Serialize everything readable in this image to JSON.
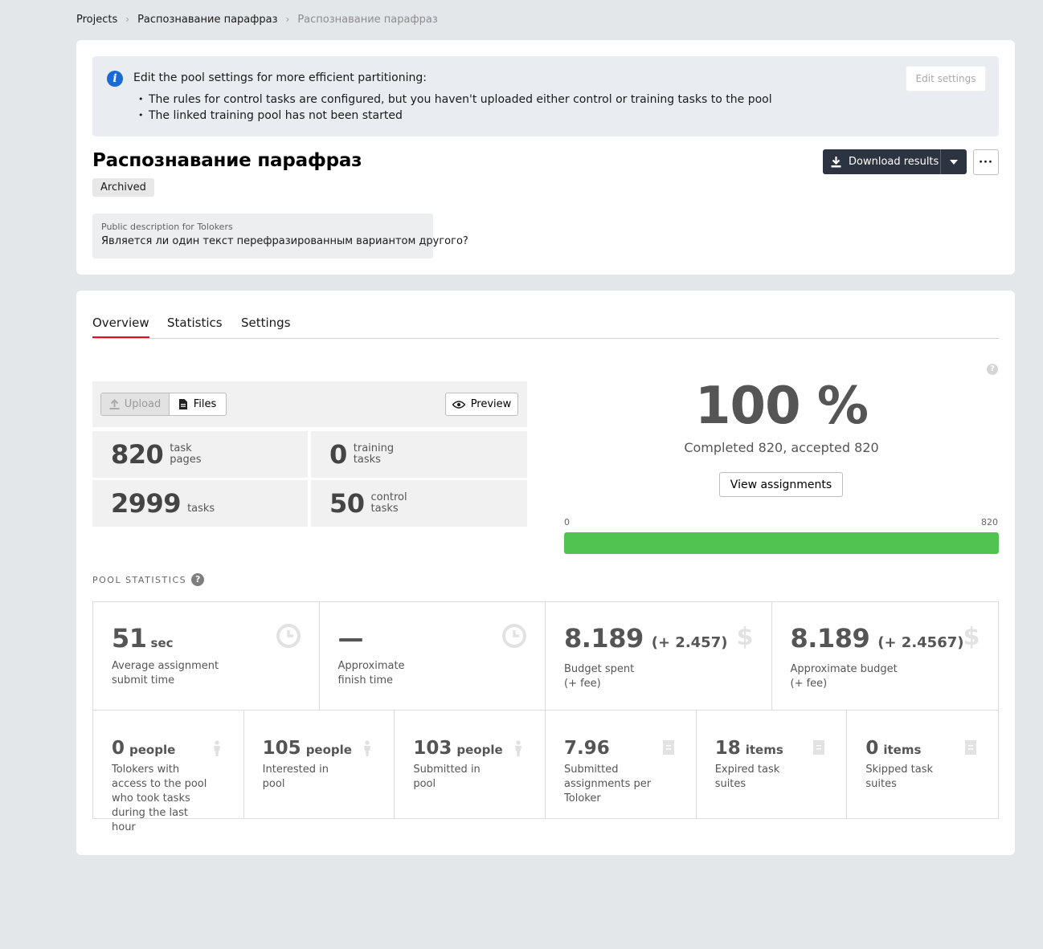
{
  "breadcrumb": {
    "items": [
      "Projects",
      "Распознавание парафраз"
    ],
    "current": "Распознавание парафраз"
  },
  "notice": {
    "title": "Edit the pool settings for more efficient partitioning:",
    "items": [
      "The rules for control tasks are configured, but you haven't uploaded either control or training tasks to the pool",
      "The linked training pool has not been started"
    ],
    "edit_button": "Edit settings"
  },
  "pool": {
    "title": "Распознавание парафраз",
    "status": "Archived",
    "description_label": "Public description for Tolokers",
    "description": "Является ли один текст перефразированным вариантом другого?"
  },
  "actions": {
    "download_label": "Download results",
    "more_label": "···"
  },
  "tabs": [
    "Overview",
    "Statistics",
    "Settings"
  ],
  "upload": {
    "upload_label": "Upload",
    "files_label": "Files",
    "preview_label": "Preview"
  },
  "counts": [
    {
      "value": "820",
      "label_1": "task",
      "label_2": "pages"
    },
    {
      "value": "0",
      "label_1": "training",
      "label_2": "tasks"
    },
    {
      "value": "2999",
      "label_1": "",
      "label_2": "tasks"
    },
    {
      "value": "50",
      "label_1": "control",
      "label_2": "tasks"
    }
  ],
  "progress": {
    "percent_text": "100 %",
    "completed_text": "Completed 820, accepted 820",
    "view_button": "View assignments",
    "scale_min": "0",
    "scale_max": "820",
    "fill_fraction": 1.0,
    "bar_color": "#51c351"
  },
  "pool_statistics": {
    "heading": "POOL STATISTICS",
    "row1": [
      {
        "value": "51",
        "unit": "sec",
        "label_1": "Average assignment",
        "label_2": "submit time",
        "icon": "clock-icon"
      },
      {
        "value": "—",
        "unit": "",
        "label_1": "Approximate",
        "label_2": "finish time",
        "icon": "clock-icon"
      },
      {
        "value": "8.189",
        "fee": "(+ 2.457)",
        "label_1": "Budget spent",
        "label_2": "(+ fee)",
        "icon": "dollar-icon"
      },
      {
        "value": "8.189",
        "fee": "(+ 2.4567)",
        "label_1": "Approximate budget",
        "label_2": "(+ fee)",
        "icon": "dollar-icon"
      }
    ],
    "row2": [
      {
        "value": "0",
        "unit": "people",
        "label": "Tolokers with access to the pool who took tasks during the last hour",
        "icon": "person-icon"
      },
      {
        "value": "105",
        "unit": "people",
        "label": "Interested in pool",
        "icon": "person-icon"
      },
      {
        "value": "103",
        "unit": "people",
        "label": "Submitted in pool",
        "icon": "person-icon"
      },
      {
        "value": "7.96",
        "unit": "",
        "label": "Submitted assignments per Toloker",
        "icon": "document-icon"
      },
      {
        "value": "18",
        "unit": "items",
        "label": "Expired task suites",
        "icon": "document-icon"
      },
      {
        "value": "0",
        "unit": "items",
        "label": "Skipped task suites",
        "icon": "document-icon"
      }
    ]
  },
  "colors": {
    "accent_tab": "#e60e1e",
    "info": "#1a6bd6",
    "primary_button": "#2b3440"
  }
}
